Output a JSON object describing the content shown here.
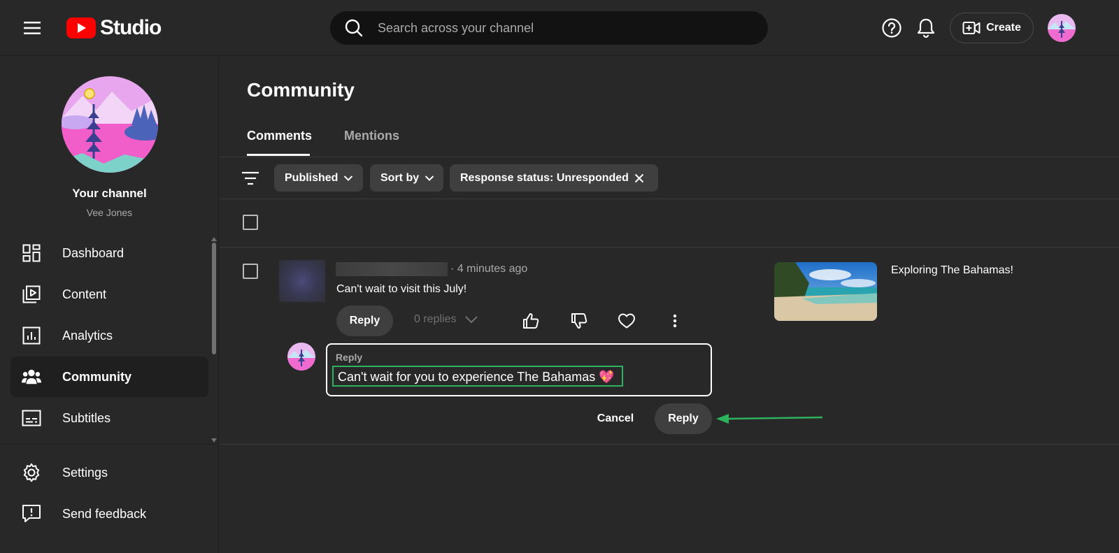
{
  "header": {
    "logo_text": "Studio",
    "search_placeholder": "Search across your channel",
    "create_label": "Create"
  },
  "sidebar": {
    "channel_title": "Your channel",
    "channel_name": "Vee Jones",
    "items": [
      {
        "label": "Dashboard",
        "icon": "dashboard-icon"
      },
      {
        "label": "Content",
        "icon": "content-icon"
      },
      {
        "label": "Analytics",
        "icon": "analytics-icon"
      },
      {
        "label": "Community",
        "icon": "community-icon",
        "active": true
      },
      {
        "label": "Subtitles",
        "icon": "subtitles-icon"
      },
      {
        "label": "Settings",
        "icon": "settings-icon"
      },
      {
        "label": "Send feedback",
        "icon": "feedback-icon"
      }
    ]
  },
  "main": {
    "page_title": "Community",
    "tabs": [
      {
        "label": "Comments",
        "active": true
      },
      {
        "label": "Mentions",
        "active": false
      }
    ],
    "filters": [
      {
        "label": "Published"
      },
      {
        "label": "Sort by"
      },
      {
        "label": "Response status: Unresponded"
      }
    ],
    "comment": {
      "time": "4 minutes ago",
      "text": "Can't wait to visit this July!",
      "reply_label": "Reply",
      "replies_label": "0 replies",
      "video_title": "Exploring The Bahamas!"
    },
    "reply_box": {
      "label": "Reply",
      "value": "Can't wait for you to experience The Bahamas 💖",
      "cancel_label": "Cancel",
      "submit_label": "Reply"
    }
  },
  "colors": {
    "background": "#282828",
    "chip": "#3f3f3f",
    "highlight": "#2db35d",
    "brand_red": "#ff0000"
  }
}
